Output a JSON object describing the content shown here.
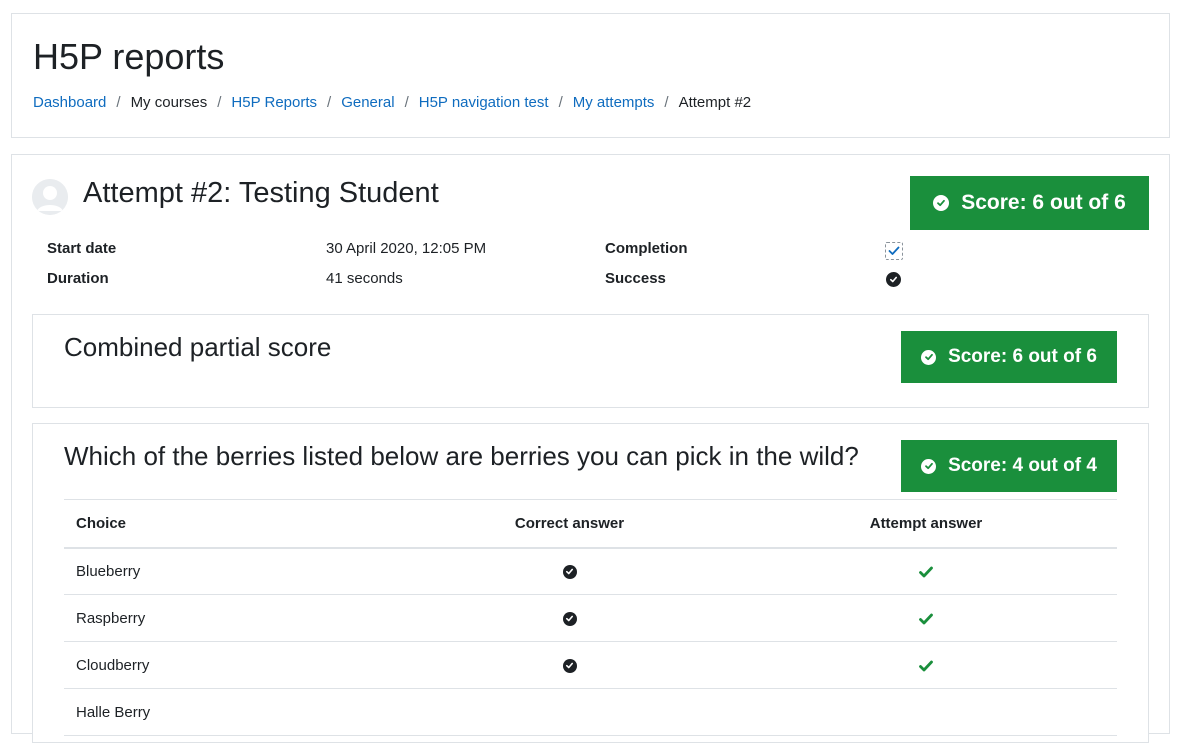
{
  "header": {
    "title": "H5P reports",
    "breadcrumb": {
      "dashboard": "Dashboard",
      "my_courses": "My courses",
      "h5p_reports": "H5P Reports",
      "general": "General",
      "h5p_navigation_test": "H5P navigation test",
      "my_attempts": "My attempts",
      "attempt": "Attempt #2"
    },
    "separator": "/"
  },
  "attempt": {
    "title": "Attempt #2: Testing Student",
    "score": "Score: 6 out of 6",
    "start_date_label": "Start date",
    "start_date_value": "30 April 2020, 12:05 PM",
    "duration_label": "Duration",
    "duration_value": "41 seconds",
    "completion_label": "Completion",
    "success_label": "Success"
  },
  "partial": {
    "title": "Combined partial score",
    "score": "Score: 6 out of 6"
  },
  "question": {
    "title": "Which of the berries listed below are berries you can pick in the wild?",
    "score": "Score: 4 out of 4",
    "columns": {
      "choice": "Choice",
      "correct": "Correct answer",
      "attempt": "Attempt answer"
    },
    "rows": [
      {
        "choice": "Blueberry"
      },
      {
        "choice": "Raspberry"
      },
      {
        "choice": "Cloudberry"
      },
      {
        "choice": "Halle Berry"
      }
    ]
  },
  "colors": {
    "success": "#1a8f3c",
    "link": "#0f6cbf",
    "text": "#1d2125",
    "border": "#dee2e6"
  }
}
